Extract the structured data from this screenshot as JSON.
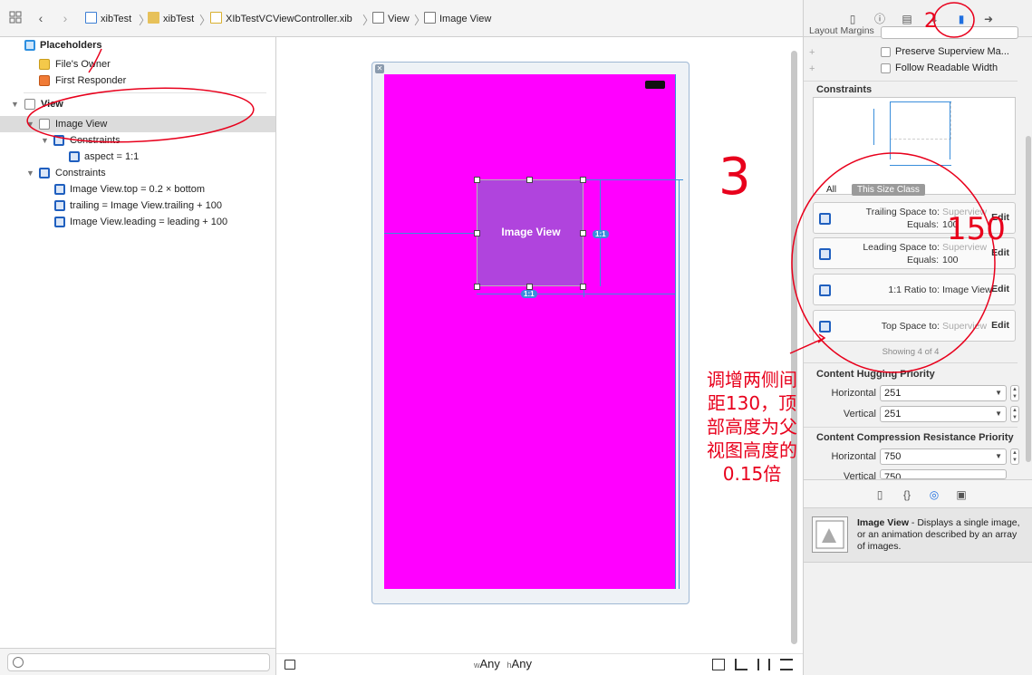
{
  "breadcrumb": {
    "items": [
      "xibTest",
      "xibTest",
      "XIbTestVCViewController.xib",
      "View",
      "Image View"
    ]
  },
  "outline": {
    "placeholders_label": "Placeholders",
    "files_owner": "File's Owner",
    "first_responder": "First Responder",
    "view_label": "View",
    "image_view_label": "Image View",
    "constraints_label": "Constraints",
    "aspect_label": "aspect = 1:1",
    "constraints2_label": "Constraints",
    "c_top": "Image View.top = 0.2 × bottom",
    "c_trailing": "trailing = Image View.trailing + 100",
    "c_leading": "Image View.leading = leading + 100"
  },
  "canvas": {
    "image_view_text": "Image View",
    "badge_right": "1:1",
    "badge_bottom": "1:1",
    "size_class_w_prefix": "w",
    "size_class_w": "Any",
    "size_class_h_prefix": "h",
    "size_class_h": "Any"
  },
  "inspector": {
    "layout_margins": "Layout Margins",
    "preserve_superview": "Preserve Superview Ma...",
    "follow_readable": "Follow Readable Width",
    "constraints_title": "Constraints",
    "seg_all": "All",
    "seg_size_class": "This Size Class",
    "cards": [
      {
        "label1": "Trailing Space to:",
        "value1": "Superview",
        "label2": "Equals:",
        "value2": "100",
        "edit": "Edit"
      },
      {
        "label1": "Leading Space to:",
        "value1": "Superview",
        "label2": "Equals:",
        "value2": "100",
        "edit": "Edit"
      },
      {
        "label1": "1:1 Ratio to:",
        "value1": "Image View",
        "edit": "Edit"
      },
      {
        "label1": "Top Space to:",
        "value1": "Superview",
        "edit": "Edit"
      }
    ],
    "showing": "Showing 4 of 4",
    "hugging_title": "Content Hugging Priority",
    "horizontal_label": "Horizontal",
    "vertical_label": "Vertical",
    "hugging_h": "251",
    "hugging_v": "251",
    "compression_title": "Content Compression Resistance Priority",
    "compression_h": "750",
    "compression_v": "750"
  },
  "library": {
    "item_title": "Image View",
    "item_desc": " - Displays a single image, or an animation described by an array of images."
  },
  "annotations": {
    "number_3": "3",
    "number_150": "150",
    "note_line1": "调增两侧间",
    "note_line2": "距130，顶",
    "note_line3": "部高度为父",
    "note_line4": "视图高度的",
    "note_line5": "0.15倍"
  },
  "colors": {
    "root_view": "#ff00ff",
    "image_view": "#b044dd",
    "constraint_blue": "#3a8edb",
    "annotation_red": "#e8001c"
  }
}
